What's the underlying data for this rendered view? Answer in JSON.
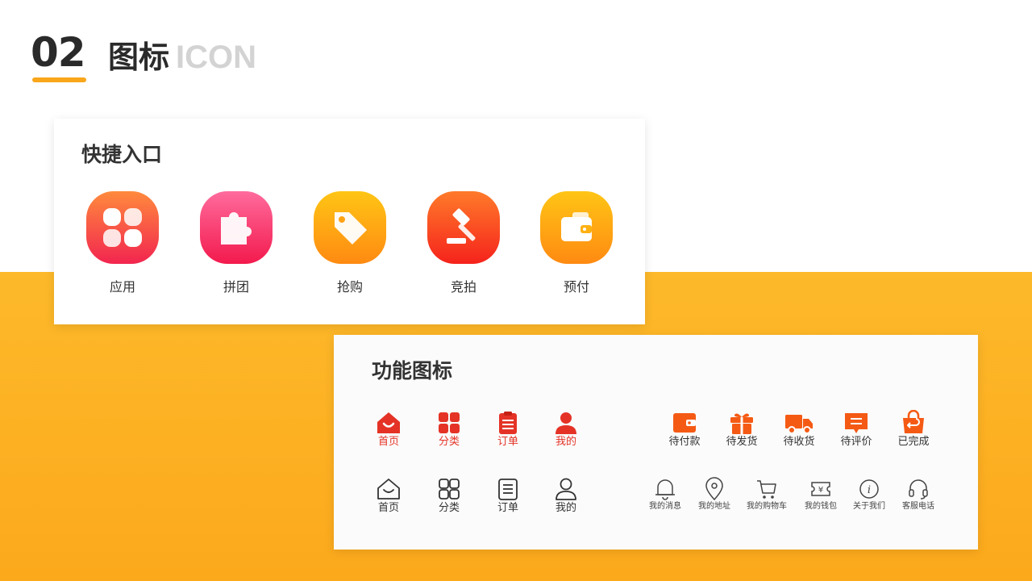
{
  "header": {
    "number": "02",
    "title_cn": "图标",
    "title_en": "ICON"
  },
  "quick": {
    "title": "快捷入口",
    "items": [
      {
        "label": "应用",
        "icon": "clover-icon",
        "color_top": "#ff8a3d",
        "color_bottom": "#f2254f"
      },
      {
        "label": "拼团",
        "icon": "puzzle-icon",
        "color_top": "#ff6b9d",
        "color_bottom": "#f31a4d"
      },
      {
        "label": "抢购",
        "icon": "tag-icon",
        "color_top": "#ffc515",
        "color_bottom": "#ff8a12"
      },
      {
        "label": "竞拍",
        "icon": "gavel-icon",
        "color_top": "#ff7a2a",
        "color_bottom": "#f5231c"
      },
      {
        "label": "预付",
        "icon": "wallet-icon",
        "color_top": "#ffc515",
        "color_bottom": "#ff8a12"
      }
    ]
  },
  "functions": {
    "title": "功能图标",
    "tabs_active": [
      {
        "label": "首页",
        "icon": "home-icon"
      },
      {
        "label": "分类",
        "icon": "category-icon"
      },
      {
        "label": "订单",
        "icon": "order-icon"
      },
      {
        "label": "我的",
        "icon": "user-icon"
      }
    ],
    "tabs_inactive": [
      {
        "label": "首页",
        "icon": "home-icon"
      },
      {
        "label": "分类",
        "icon": "category-icon"
      },
      {
        "label": "订单",
        "icon": "order-icon"
      },
      {
        "label": "我的",
        "icon": "user-icon"
      }
    ],
    "orders": [
      {
        "label": "待付款",
        "icon": "wallet-icon"
      },
      {
        "label": "待发货",
        "icon": "gift-icon"
      },
      {
        "label": "待收货",
        "icon": "truck-icon"
      },
      {
        "label": "待评价",
        "icon": "comment-icon"
      },
      {
        "label": "已完成",
        "icon": "bag-return-icon"
      }
    ],
    "services": [
      {
        "label": "我的消息",
        "icon": "bell-icon"
      },
      {
        "label": "我的地址",
        "icon": "location-icon"
      },
      {
        "label": "我的购物车",
        "icon": "cart-icon"
      },
      {
        "label": "我的钱包",
        "icon": "ticket-yen-icon",
        "glyph": "¥"
      },
      {
        "label": "关于我们",
        "icon": "info-icon",
        "glyph": "i"
      },
      {
        "label": "客服电话",
        "icon": "headset-icon"
      }
    ]
  },
  "colors": {
    "accent": "#f9a61a",
    "band_top": "#fdb92a",
    "band_bottom": "#fca91c",
    "tab_active": "#e43326",
    "order_orange": "#f55a14",
    "text_dark": "#2a2a2a",
    "title_en": "#d3d3d3"
  }
}
